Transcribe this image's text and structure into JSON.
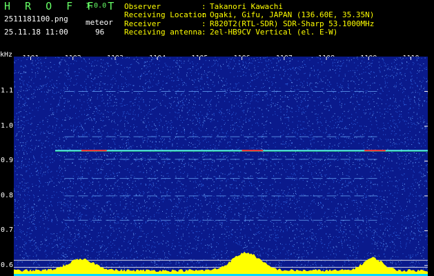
{
  "header": {
    "brand": "H R O F F T",
    "version": "1.0.0",
    "filename": "2511181100.png",
    "datetime": "25.11.18 11:00",
    "meteor_label": "meteor",
    "meteor_count": "96"
  },
  "meta": [
    {
      "label": "Observer",
      "value": "Takanori Kawachi"
    },
    {
      "label": "Receiving Location",
      "value": "Ogaki, Gifu, JAPAN (136.60E, 35.35N)"
    },
    {
      "label": "Receiver",
      "value": "R820T2(RTL-SDR) SDR-Sharp 53.1000MHz"
    },
    {
      "label": "Receiving antenna",
      "value": "2el-HB9CV Vertical (el. E-W)"
    }
  ],
  "meta_separator": ":",
  "chart_data": {
    "type": "heatmap",
    "ylabel": "kHz",
    "x_ticks": [
      "1101",
      "1102",
      "1103",
      "1104",
      "1105",
      "1106",
      "1107",
      "1108",
      "1109",
      "1110"
    ],
    "y_ticks": [
      "1.1",
      "1.0",
      "0.9",
      "0.8",
      "0.7",
      "0.6"
    ],
    "xlim": [
      1100.6,
      1110.4
    ],
    "ylim": [
      0.57,
      1.2
    ],
    "carrier_khz": 0.93,
    "faint_lines_khz": [
      1.1,
      0.97,
      0.905,
      0.85,
      0.8,
      0.73
    ],
    "colors": {
      "background": "#0a1a8c",
      "noise": "#3a7cff",
      "carrier": "#66ffff",
      "hot": "#ff3030",
      "profile": "#ffff00",
      "base": "#00d8ff"
    }
  }
}
